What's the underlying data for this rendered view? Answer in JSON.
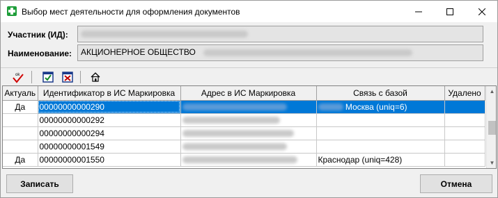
{
  "window": {
    "title": "Выбор мест деятельности для оформления документов"
  },
  "fields": {
    "participant_label": "Участник (ИД):",
    "participant_value": "",
    "name_label": "Наименование:",
    "name_value": "АКЦИОНЕРНОЕ ОБЩЕСТВО"
  },
  "toolbar": {
    "items": [
      "check-ok-icon",
      "select-all-icon",
      "deselect-all-icon",
      "home-icon"
    ]
  },
  "grid": {
    "columns": [
      "Актуаль",
      "Идентификатор в ИС Маркировка",
      "Адрес в ИС Маркировка",
      "Связь с базой",
      "Удалено"
    ],
    "rows": [
      {
        "actual": "Да",
        "id": "00000000000290",
        "address": "",
        "link": "Москва (uniq=6)",
        "deleted": "",
        "selected": true
      },
      {
        "actual": "",
        "id": "00000000000292",
        "address": "",
        "link": "",
        "deleted": "",
        "selected": false
      },
      {
        "actual": "",
        "id": "00000000000294",
        "address": "",
        "link": "",
        "deleted": "",
        "selected": false
      },
      {
        "actual": "",
        "id": "00000000001549",
        "address": "",
        "link": "",
        "deleted": "",
        "selected": false
      },
      {
        "actual": "Да",
        "id": "00000000001550",
        "address": "",
        "link": "Краснодар (uniq=428)",
        "deleted": "",
        "selected": false
      }
    ]
  },
  "buttons": {
    "save_label": "Записать",
    "cancel_label": "Отмена"
  }
}
